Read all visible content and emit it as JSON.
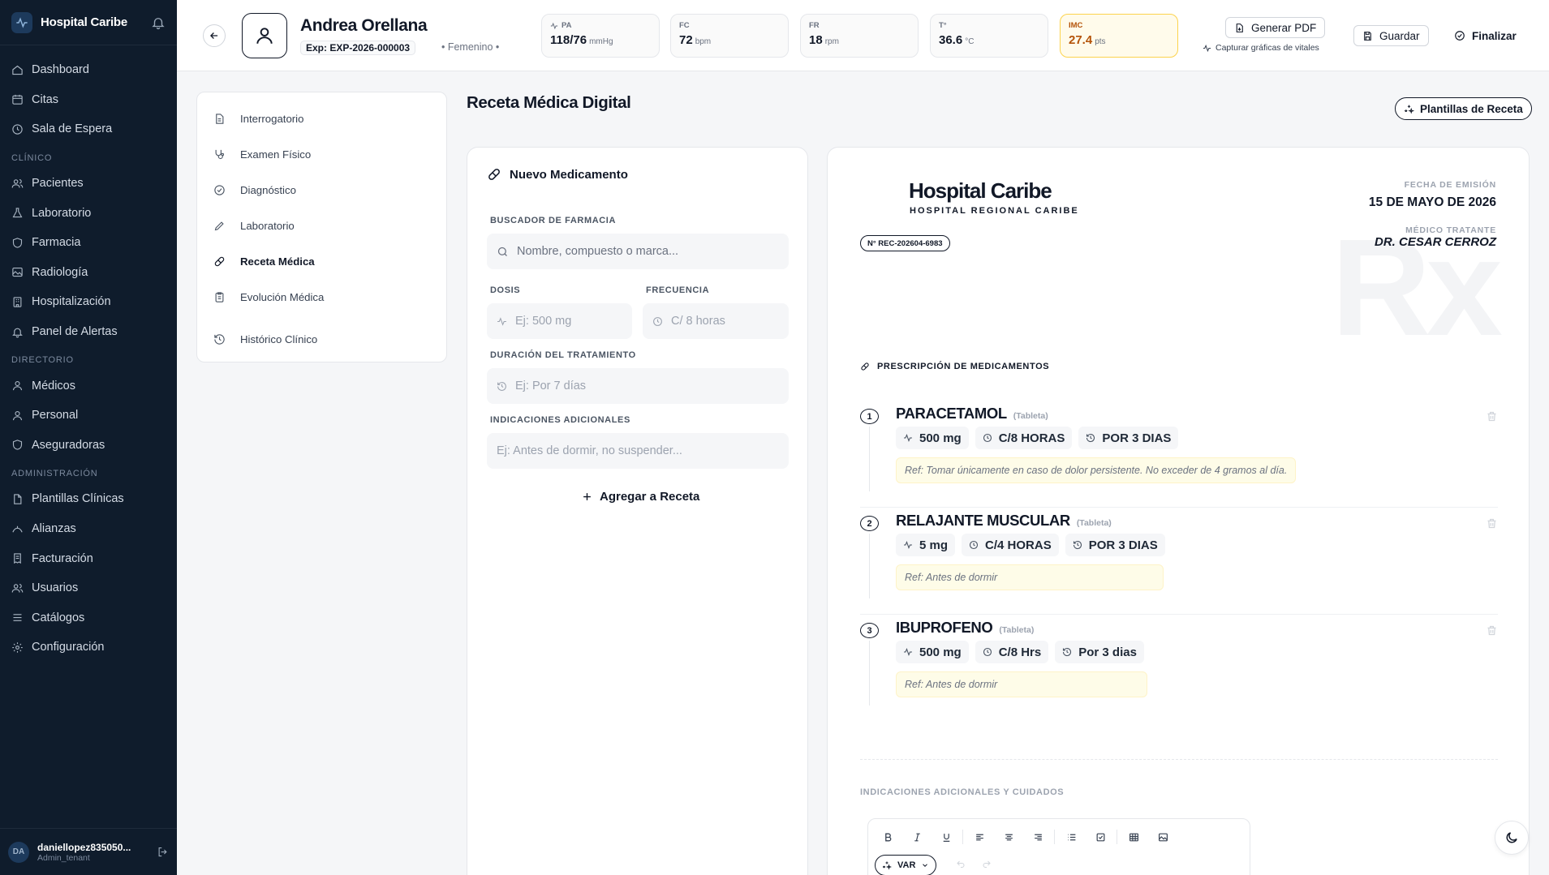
{
  "sidebar": {
    "brand": "Hospital Caribe",
    "items_main": [
      {
        "label": "Dashboard",
        "icon": "home-icon"
      },
      {
        "label": "Citas",
        "icon": "calendar-icon"
      },
      {
        "label": "Sala de Espera",
        "icon": "clock-icon"
      }
    ],
    "section_clinico": "CLÍNICO",
    "items_clinico": [
      {
        "label": "Pacientes",
        "icon": "users-icon"
      },
      {
        "label": "Laboratorio",
        "icon": "flask-icon"
      },
      {
        "label": "Farmacia",
        "icon": "shield-icon"
      },
      {
        "label": "Radiología",
        "icon": "image-icon"
      },
      {
        "label": "Hospitalización",
        "icon": "building-icon"
      },
      {
        "label": "Panel de Alertas",
        "icon": "bell-icon"
      }
    ],
    "section_directorio": "DIRECTORIO",
    "items_directorio": [
      {
        "label": "Médicos",
        "icon": "user-icon"
      },
      {
        "label": "Personal",
        "icon": "user-icon"
      },
      {
        "label": "Aseguradoras",
        "icon": "shield-icon"
      }
    ],
    "section_admin": "ADMINISTRACIÓN",
    "items_admin": [
      {
        "label": "Plantillas Clínicas",
        "icon": "file-icon"
      },
      {
        "label": "Alianzas",
        "icon": "handshake-icon"
      },
      {
        "label": "Facturación",
        "icon": "receipt-icon"
      },
      {
        "label": "Usuarios",
        "icon": "users-icon"
      },
      {
        "label": "Catálogos",
        "icon": "list-icon"
      },
      {
        "label": "Configuración",
        "icon": "gear-icon"
      }
    ],
    "user": {
      "initials": "DA",
      "name": "daniellopez835050...",
      "role": "Admin_tenant"
    }
  },
  "header": {
    "patient_name": "Andrea Orellana",
    "exp": "Exp: EXP-2026-000003",
    "gender": "• Femenino •",
    "vitals": [
      {
        "label": "PA",
        "value": "118/76",
        "unit": "mmHg"
      },
      {
        "label": "FC",
        "value": "72",
        "unit": "bpm"
      },
      {
        "label": "FR",
        "value": "18",
        "unit": "rpm"
      },
      {
        "label": "T°",
        "value": "36.6",
        "unit": "°C"
      },
      {
        "label": "IMC",
        "value": "27.4",
        "unit": "pts"
      }
    ],
    "pdf_label": "Generar PDF",
    "capture_label": "Capturar gráficas de vitales",
    "save_label": "Guardar",
    "finish_label": "Finalizar"
  },
  "steps": [
    {
      "label": "Interrogatorio",
      "icon": "clipboard-icon"
    },
    {
      "label": "Examen Físico",
      "icon": "stethoscope-icon"
    },
    {
      "label": "Diagnóstico",
      "icon": "check-circle-icon"
    },
    {
      "label": "Laboratorio",
      "icon": "pencil-icon"
    },
    {
      "label": "Receta Médica",
      "icon": "pill-icon"
    },
    {
      "label": "Evolución Médica",
      "icon": "clipboard-list-icon"
    },
    {
      "label": "Histórico Clínico",
      "icon": "history-icon"
    }
  ],
  "page": {
    "title": "Receta Médica Digital",
    "templates_label": "Plantillas de Receta"
  },
  "form": {
    "title": "Nuevo Medicamento",
    "search_label": "BUSCADOR DE FARMACIA",
    "search_placeholder": "Nombre, compuesto o marca...",
    "dose_label": "DOSIS",
    "dose_placeholder": "Ej: 500 mg",
    "freq_label": "FRECUENCIA",
    "freq_placeholder": "C/ 8 horas",
    "duration_label": "DURACIÓN DEL TRATAMIENTO",
    "duration_placeholder": "Ej: Por 7 días",
    "ind_label": "INDICACIONES ADICIONALES",
    "ind_placeholder": "Ej: Antes de dormir, no suspender...",
    "add_label": "Agregar a Receta"
  },
  "rx": {
    "hospital": "Hospital Caribe",
    "hospital_sub": "HOSPITAL REGIONAL CARIBE",
    "number": "N° REC-202604-6983",
    "date_label": "FECHA DE EMISIÓN",
    "date_value": "15 DE MAYO DE 2026",
    "doctor_label": "MÉDICO TRATANTE",
    "doctor_value": "DR. CESAR CERROZ",
    "watermark": "Rx",
    "section_title": "PRESCRIPCIÓN DE MEDICAMENTOS",
    "meds": [
      {
        "num": "1",
        "name": "PARACETAMOL",
        "form": "(Tableta)",
        "dose": "500 mg",
        "freq": "C/8 HORAS",
        "duration": "POR 3 DIAS",
        "note": "Ref: Tomar únicamente en caso de dolor persistente. No exceder de 4 gramos al día."
      },
      {
        "num": "2",
        "name": "RELAJANTE MUSCULAR",
        "form": "(Tableta)",
        "dose": "5 mg",
        "freq": "C/4 HORAS",
        "duration": "POR 3 DIAS",
        "note": "Ref: Antes de dormir"
      },
      {
        "num": "3",
        "name": "IBUPROFENO",
        "form": "(Tableta)",
        "dose": "500 mg",
        "freq": "C/8 Hrs",
        "duration": "Por 3 dias",
        "note": "Ref: Antes de dormir"
      }
    ],
    "ind_title": "INDICACIONES ADICIONALES Y CUIDADOS",
    "var_label": "VAR"
  },
  "colors": {
    "sidebar_bg": "#0f1c2c",
    "imc_warn": "#b45309",
    "note_bg": "#fefce8"
  }
}
